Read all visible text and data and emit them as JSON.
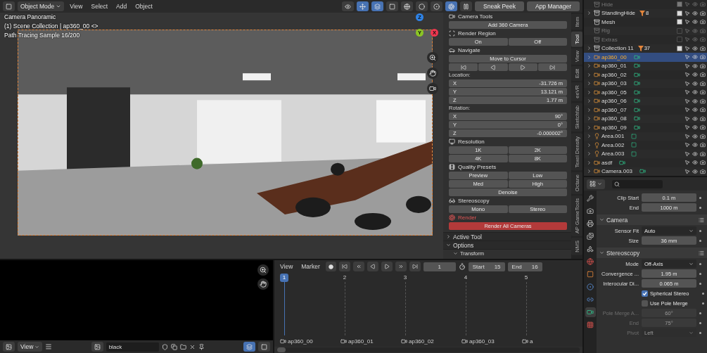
{
  "viewport": {
    "header": {
      "mode": "Object Mode",
      "menus": [
        "View",
        "Select",
        "Add",
        "Object"
      ],
      "toggles": [
        {
          "kind": "visibility",
          "selected": false
        },
        {
          "kind": "gizmo",
          "selected": true
        },
        {
          "kind": "overlay",
          "selected": true
        },
        {
          "kind": "xray",
          "selected": false
        },
        {
          "kind": "wireframe",
          "selected": false
        },
        {
          "kind": "solid",
          "selected": false
        },
        {
          "kind": "material",
          "selected": false
        },
        {
          "kind": "rendered",
          "selected": true
        }
      ],
      "buttons": [
        "Sneak Peek",
        "App Manager"
      ]
    },
    "overlay_lines": [
      "Camera Panoramic",
      "(1) Scene Collection | ap360_00 <>",
      "Path Tracing Sample 16/200"
    ],
    "gizmo": [
      {
        "label": "Z",
        "color": "#2f83e6"
      },
      {
        "label": "Y",
        "color": "#8bc525"
      },
      {
        "label": "X",
        "color": "#f0364f"
      }
    ]
  },
  "npanel": {
    "rows": [
      {
        "kind": "heading",
        "label": "Camera Tools"
      },
      {
        "kind": "buttons",
        "items": [
          "Add 360 Camera"
        ]
      },
      {
        "kind": "heading",
        "label": "Render Region"
      },
      {
        "kind": "buttons",
        "items": [
          "On",
          "Off"
        ]
      },
      {
        "kind": "heading",
        "label": "Navigate"
      },
      {
        "kind": "buttons",
        "items": [
          "Move to Cursor"
        ]
      },
      {
        "kind": "transport"
      },
      {
        "kind": "label",
        "label": "Location:"
      },
      {
        "kind": "fields",
        "items": [
          {
            "axis": "X",
            "value": "-31.726 m"
          },
          {
            "axis": "Y",
            "value": "13.121 m"
          },
          {
            "axis": "Z",
            "value": "1.77 m"
          }
        ]
      },
      {
        "kind": "label",
        "label": "Rotation:"
      },
      {
        "kind": "fields",
        "items": [
          {
            "axis": "X",
            "value": "90°"
          },
          {
            "axis": "Y",
            "value": "0°"
          },
          {
            "axis": "Z",
            "value": "-0.000002°"
          }
        ]
      },
      {
        "kind": "heading",
        "label": "Resolution"
      },
      {
        "kind": "buttons",
        "items": [
          "1K",
          "2K"
        ]
      },
      {
        "kind": "buttons",
        "items": [
          "4K",
          "8K"
        ]
      },
      {
        "kind": "heading",
        "label": "Quality Presets"
      },
      {
        "kind": "buttons",
        "items": [
          "Preview",
          "Low"
        ]
      },
      {
        "kind": "buttons",
        "items": [
          "Med",
          "High"
        ]
      },
      {
        "kind": "buttons",
        "items": [
          "Denoise"
        ]
      },
      {
        "kind": "heading",
        "label": "Stereoscopy"
      },
      {
        "kind": "buttons",
        "items": [
          "Mono",
          "Stereo"
        ]
      },
      {
        "kind": "alert",
        "label": "Render"
      },
      {
        "kind": "alertbuttons",
        "items": [
          "Render All Cameras"
        ]
      }
    ],
    "panels": [
      {
        "label": "Active Tool",
        "expanded": false
      },
      {
        "label": "Options",
        "expanded": true
      },
      {
        "label": "Transform",
        "expanded": true
      }
    ],
    "tabs": [
      {
        "label": "Item",
        "selected": false
      },
      {
        "label": "Tool",
        "selected": true
      },
      {
        "label": "View",
        "selected": false
      },
      {
        "label": "Edit",
        "selected": false
      },
      {
        "label": "eeVR",
        "selected": false
      },
      {
        "label": "Sketchfab",
        "selected": false
      },
      {
        "label": "Texel Density",
        "selected": false
      },
      {
        "label": "Octane",
        "selected": false
      },
      {
        "label": "AP GameTools",
        "selected": false
      },
      {
        "label": "NMS",
        "selected": false
      }
    ]
  },
  "image_editor": {
    "menus": [
      "View"
    ],
    "image_name": "black"
  },
  "timeline": {
    "menus": [
      "View",
      "Marker"
    ],
    "frame": "1",
    "start_label": "Start",
    "start": "15",
    "end_label": "End",
    "end": "16",
    "frames": [
      {
        "label": "1",
        "selected": true,
        "marker": "ap360_00"
      },
      {
        "label": "2",
        "selected": false,
        "marker": "ap360_01"
      },
      {
        "label": "3",
        "selected": false,
        "marker": "ap360_02"
      },
      {
        "label": "4",
        "selected": false,
        "marker": "ap360_03"
      },
      {
        "label": "5",
        "selected": false,
        "marker": "a"
      }
    ]
  },
  "outliner": {
    "items": [
      {
        "kind": "collection",
        "name": "Hide",
        "expandable": false,
        "checked": true,
        "selected": false,
        "disabled": true
      },
      {
        "kind": "collection",
        "name": "StandingHide",
        "expandable": true,
        "badge": "8",
        "checked": true,
        "selected": false,
        "disabled": false
      },
      {
        "kind": "collection",
        "name": "Mesh",
        "expandable": false,
        "checked": true,
        "selected": false,
        "disabled": false
      },
      {
        "kind": "collection",
        "name": "Rig",
        "expandable": false,
        "checked": false,
        "selected": false,
        "disabled": true
      },
      {
        "kind": "collection",
        "name": "Extras",
        "expandable": false,
        "checked": false,
        "selected": false,
        "disabled": true
      },
      {
        "kind": "collection",
        "name": "Collection 11",
        "expandable": true,
        "badge": "37",
        "checked": true,
        "selected": false,
        "disabled": false
      },
      {
        "kind": "camera",
        "name": "ap360_00",
        "expandable": true,
        "selected": true,
        "disabled": false
      },
      {
        "kind": "camera",
        "name": "ap360_01",
        "expandable": true,
        "selected": false,
        "disabled": false
      },
      {
        "kind": "camera",
        "name": "ap360_02",
        "expandable": true,
        "selected": false,
        "disabled": false
      },
      {
        "kind": "camera",
        "name": "ap360_03",
        "expandable": true,
        "selected": false,
        "disabled": false
      },
      {
        "kind": "camera",
        "name": "ap360_05",
        "expandable": true,
        "selected": false,
        "disabled": false
      },
      {
        "kind": "camera",
        "name": "ap360_06",
        "expandable": true,
        "selected": false,
        "disabled": false
      },
      {
        "kind": "camera",
        "name": "ap360_07",
        "expandable": true,
        "selected": false,
        "disabled": false
      },
      {
        "kind": "camera",
        "name": "ap360_08",
        "expandable": true,
        "selected": false,
        "disabled": false
      },
      {
        "kind": "camera",
        "name": "ap360_09",
        "expandable": true,
        "selected": false,
        "disabled": false
      },
      {
        "kind": "light",
        "name": "Area.001",
        "expandable": true,
        "selected": false,
        "disabled": false
      },
      {
        "kind": "light",
        "name": "Area.002",
        "expandable": true,
        "selected": false,
        "disabled": false
      },
      {
        "kind": "light",
        "name": "Area.003",
        "expandable": true,
        "selected": false,
        "disabled": false
      },
      {
        "kind": "camera",
        "name": "asdf",
        "expandable": true,
        "selected": false,
        "disabled": false
      },
      {
        "kind": "camera",
        "name": "Camera.003",
        "expandable": true,
        "selected": false,
        "disabled": false
      }
    ]
  },
  "properties": {
    "tabs": [
      {
        "selected": false
      },
      {
        "selected": false
      },
      {
        "selected": false
      },
      {
        "selected": false
      },
      {
        "selected": false
      },
      {
        "selected": false
      },
      {
        "selected": false
      },
      {
        "selected": false
      },
      {
        "selected": false
      },
      {
        "selected": true
      },
      {
        "selected": false
      }
    ],
    "rows": [
      {
        "kind": "field",
        "label": "Clip Start",
        "value": "0.1 m",
        "disabled": false
      },
      {
        "kind": "field",
        "label": "End",
        "value": "1000 m",
        "disabled": false
      },
      {
        "kind": "panel",
        "label": "Camera",
        "expanded": true
      },
      {
        "kind": "dropdown",
        "label": "Sensor Fit",
        "value": "Auto",
        "disabled": false
      },
      {
        "kind": "field",
        "label": "Size",
        "value": "36 mm",
        "disabled": false
      },
      {
        "kind": "panel",
        "label": "Stereoscopy",
        "expanded": true
      },
      {
        "kind": "dropdown",
        "label": "Mode",
        "value": "Off-Axis",
        "disabled": false
      },
      {
        "kind": "field",
        "label": "Convergence ...",
        "value": "1.95 m",
        "disabled": false
      },
      {
        "kind": "field",
        "label": "Interocular Di...",
        "value": "0.065 m",
        "disabled": false
      },
      {
        "kind": "checkbox",
        "label": "Spherical Stereo",
        "checked": true
      },
      {
        "kind": "checkbox",
        "label": "Use Pole Merge",
        "checked": false
      },
      {
        "kind": "field",
        "label": "Pole Merge A...",
        "value": "60°",
        "disabled": true
      },
      {
        "kind": "field",
        "label": "End",
        "value": "75°",
        "disabled": true
      },
      {
        "kind": "dropdown",
        "label": "Pivot",
        "value": "Left",
        "disabled": true
      }
    ]
  }
}
